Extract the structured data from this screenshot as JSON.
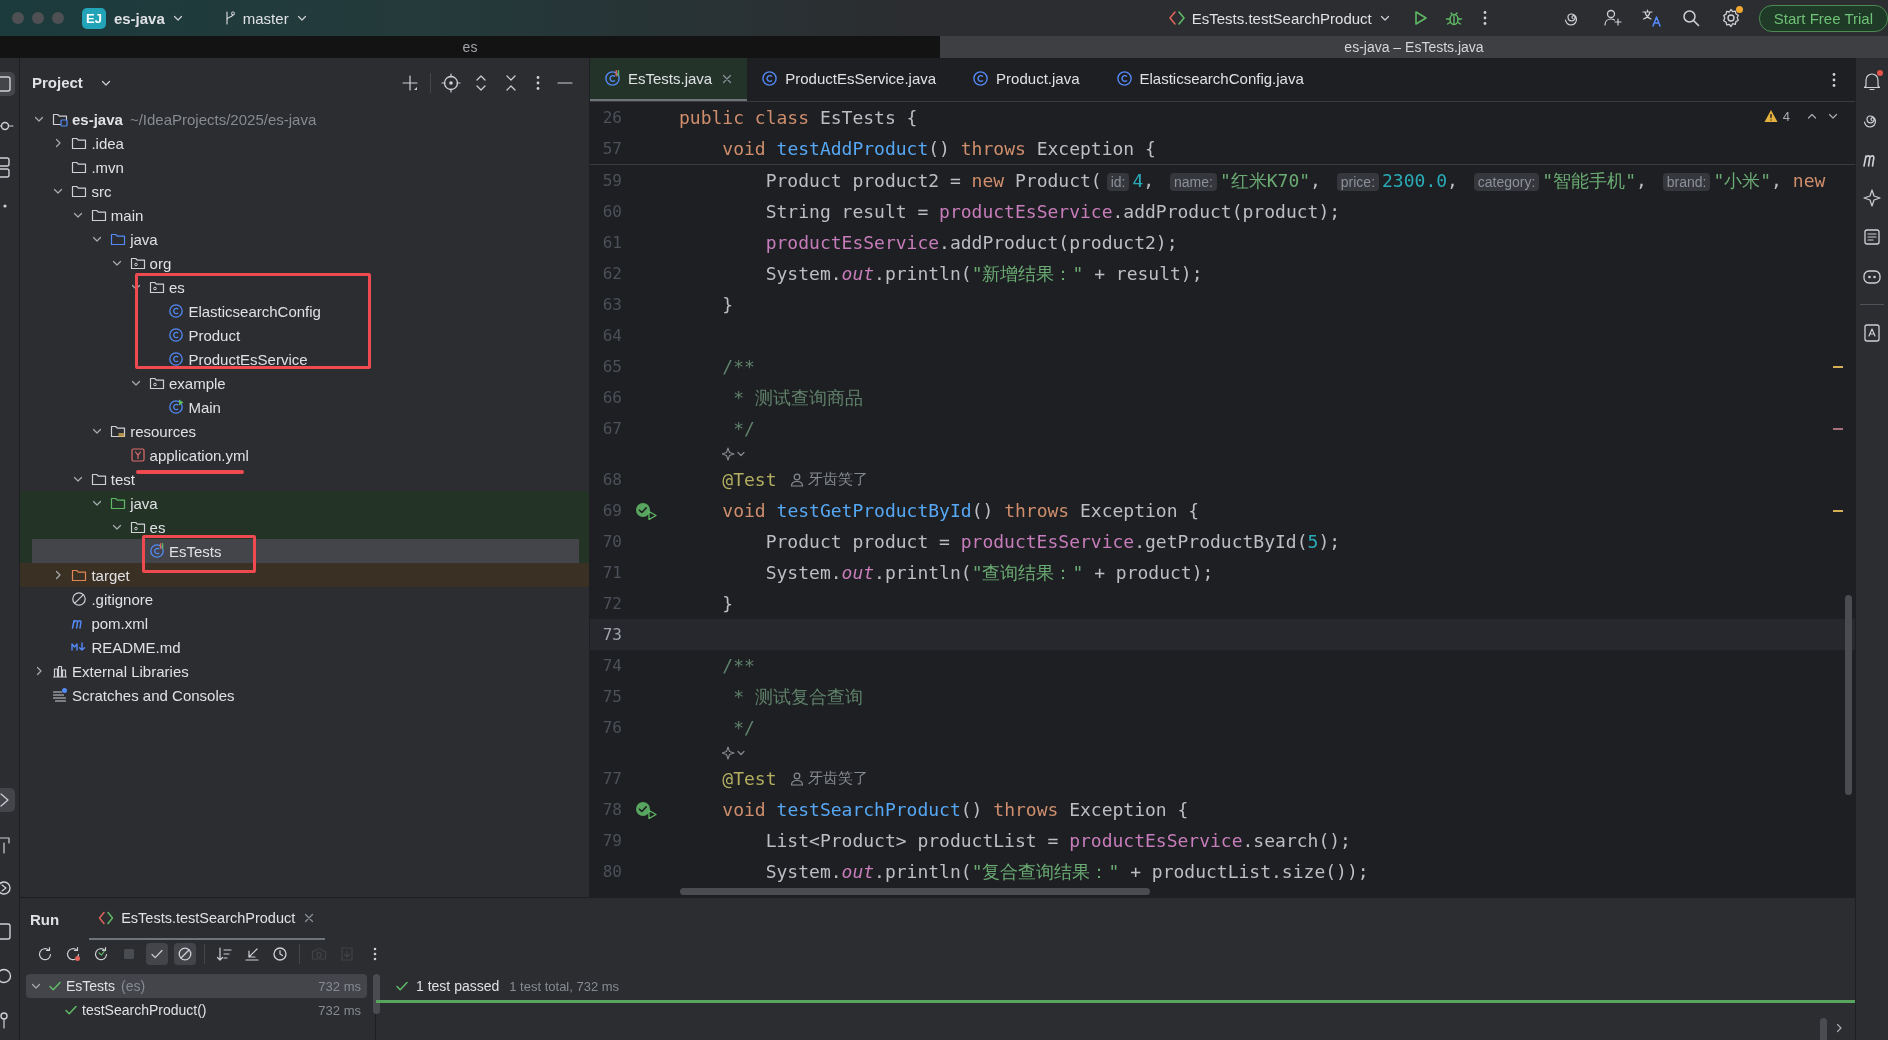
{
  "titlebar": {
    "project_badge": "EJ",
    "project": "es-java",
    "branch": "master",
    "run_config": "EsTests.testSearchProduct",
    "settings_badge": true,
    "trial_button": "Start Free Trial"
  },
  "window_tabs": [
    {
      "label": "es",
      "selected": false
    },
    {
      "label": "es-java – EsTests.java",
      "selected": true
    }
  ],
  "project_panel": {
    "title": "Project",
    "tree": [
      {
        "name": "es-java",
        "path": "~/IdeaProjects/2025/es-java",
        "kind": "module",
        "expanded": true,
        "selected": false,
        "children": [
          {
            "name": ".idea",
            "kind": "folder",
            "expanded": false,
            "selected": false
          },
          {
            "name": ".mvn",
            "kind": "folder",
            "selected": false
          },
          {
            "name": "src",
            "kind": "folder",
            "expanded": true,
            "selected": false,
            "children": [
              {
                "name": "main",
                "kind": "folder",
                "expanded": true,
                "selected": false,
                "children": [
                  {
                    "name": "java",
                    "kind": "source-folder",
                    "expanded": true,
                    "selected": false,
                    "children": [
                      {
                        "name": "org",
                        "kind": "package",
                        "expanded": true,
                        "selected": false,
                        "children": [
                          {
                            "name": "es",
                            "kind": "package",
                            "expanded": true,
                            "selected": false,
                            "children": [
                              {
                                "name": "ElasticsearchConfig",
                                "kind": "class",
                                "selected": false
                              },
                              {
                                "name": "Product",
                                "kind": "class",
                                "selected": false
                              },
                              {
                                "name": "ProductEsService",
                                "kind": "class",
                                "selected": false
                              }
                            ]
                          },
                          {
                            "name": "example",
                            "kind": "package",
                            "expanded": true,
                            "selected": false,
                            "children": [
                              {
                                "name": "Main",
                                "kind": "main-class",
                                "selected": false
                              }
                            ]
                          }
                        ]
                      }
                    ]
                  },
                  {
                    "name": "resources",
                    "kind": "resources",
                    "expanded": true,
                    "selected": false,
                    "children": [
                      {
                        "name": "application.yml",
                        "kind": "yaml",
                        "selected": false
                      }
                    ]
                  }
                ]
              },
              {
                "name": "test",
                "kind": "folder",
                "expanded": true,
                "selected": false,
                "children": [
                  {
                    "name": "java",
                    "kind": "test-folder",
                    "expanded": true,
                    "selected": false,
                    "test_scope": true,
                    "children": [
                      {
                        "name": "es",
                        "kind": "package",
                        "expanded": true,
                        "selected": false,
                        "test_scope": true,
                        "children": [
                          {
                            "name": "EsTests",
                            "kind": "test-class",
                            "selected": true,
                            "test_scope": true
                          }
                        ]
                      }
                    ]
                  }
                ]
              }
            ]
          },
          {
            "name": "target",
            "kind": "excluded-folder",
            "expanded": false,
            "selected": false,
            "excluded": true
          },
          {
            "name": ".gitignore",
            "kind": "ignore",
            "selected": false
          },
          {
            "name": "pom.xml",
            "kind": "maven",
            "selected": false
          },
          {
            "name": "README.md",
            "kind": "markdown",
            "selected": false
          }
        ]
      },
      {
        "name": "External Libraries",
        "kind": "libraries",
        "expanded": false,
        "selected": false
      },
      {
        "name": "Scratches and Consoles",
        "kind": "scratches",
        "selected": false
      }
    ]
  },
  "markups": [
    {
      "kind": "box"
    },
    {
      "kind": "underline"
    },
    {
      "kind": "box"
    }
  ],
  "editor": {
    "tabs": [
      {
        "label": "EsTests.java",
        "kind": "test-class",
        "selected": true
      },
      {
        "label": "ProductEsService.java",
        "kind": "class",
        "selected": false
      },
      {
        "label": "Product.java",
        "kind": "class",
        "selected": false
      },
      {
        "label": "ElasticsearchConfig.java",
        "kind": "class",
        "selected": false
      }
    ],
    "warnings": "4",
    "sticky_lines": [
      {
        "number": "26",
        "tokens": [
          {
            "kind": "kw",
            "text": "public class "
          },
          {
            "kind": "plain",
            "text": "EsTests {"
          }
        ]
      },
      {
        "number": "57",
        "tokens": [
          {
            "kind": "kw",
            "text": "    void "
          },
          {
            "kind": "decl",
            "text": "testAddProduct"
          },
          {
            "kind": "plain",
            "text": "() "
          },
          {
            "kind": "kw",
            "text": "throws "
          },
          {
            "kind": "plain",
            "text": "Exception {"
          }
        ]
      }
    ],
    "lines": [
      {
        "kind": "code",
        "number": "59",
        "current": false,
        "tokens": [
          {
            "kind": "plain",
            "text": "        Product product2 = "
          },
          {
            "kind": "kw",
            "text": "new "
          },
          {
            "kind": "plain",
            "text": "Product("
          },
          {
            "kind": "hint",
            "text": "id:"
          },
          {
            "kind": "num",
            "text": "4"
          },
          {
            "kind": "plain",
            "text": ", "
          },
          {
            "kind": "hint",
            "text": "name:"
          },
          {
            "kind": "str",
            "text": "\"红米K70\""
          },
          {
            "kind": "plain",
            "text": ", "
          },
          {
            "kind": "hint",
            "text": "price:"
          },
          {
            "kind": "num",
            "text": "2300.0"
          },
          {
            "kind": "plain",
            "text": ", "
          },
          {
            "kind": "hint",
            "text": "category:"
          },
          {
            "kind": "str",
            "text": "\"智能手机\""
          },
          {
            "kind": "plain",
            "text": ", "
          },
          {
            "kind": "hint",
            "text": "brand:"
          },
          {
            "kind": "str",
            "text": "\"小米\""
          },
          {
            "kind": "plain",
            "text": ", "
          },
          {
            "kind": "kw",
            "text": "new"
          }
        ]
      },
      {
        "kind": "code",
        "number": "60",
        "current": false,
        "tokens": [
          {
            "kind": "plain",
            "text": "        String result = "
          },
          {
            "kind": "field",
            "text": "productEsService"
          },
          {
            "kind": "plain",
            "text": ".addProduct(product);"
          }
        ]
      },
      {
        "kind": "code",
        "number": "61",
        "current": false,
        "tokens": [
          {
            "kind": "field",
            "text": "        productEsService"
          },
          {
            "kind": "plain",
            "text": ".addProduct(product2);"
          }
        ]
      },
      {
        "kind": "code",
        "number": "62",
        "current": false,
        "tokens": [
          {
            "kind": "plain",
            "text": "        System."
          },
          {
            "kind": "static",
            "text": "out"
          },
          {
            "kind": "plain",
            "text": ".println("
          },
          {
            "kind": "str",
            "text": "\"新增结果：\""
          },
          {
            "kind": "plain",
            "text": " + result);"
          }
        ]
      },
      {
        "kind": "code",
        "number": "63",
        "current": false,
        "tokens": [
          {
            "kind": "plain",
            "text": "    }"
          }
        ]
      },
      {
        "kind": "code",
        "number": "64",
        "current": false
      },
      {
        "kind": "code",
        "number": "65",
        "current": false,
        "warning_mark": true,
        "tokens": [
          {
            "kind": "doc",
            "text": "    /**"
          }
        ]
      },
      {
        "kind": "code",
        "number": "66",
        "current": false,
        "tokens": [
          {
            "kind": "doc",
            "text": "     * 测试查询商品"
          }
        ]
      },
      {
        "kind": "code",
        "number": "67",
        "current": false,
        "typo_mark": true,
        "tokens": [
          {
            "kind": "doc",
            "text": "     */"
          }
        ]
      },
      {
        "kind": "vision"
      },
      {
        "kind": "code",
        "number": "68",
        "current": false,
        "tokens": [
          {
            "kind": "annot",
            "text": "    @Test"
          }
        ],
        "author": "牙齿笑了"
      },
      {
        "kind": "code",
        "number": "69",
        "current": false,
        "test_passed": true,
        "warning_mark": true,
        "tokens": [
          {
            "kind": "kw",
            "text": "    void "
          },
          {
            "kind": "decl",
            "text": "testGetProductById"
          },
          {
            "kind": "plain",
            "text": "() "
          },
          {
            "kind": "kw",
            "text": "throws "
          },
          {
            "kind": "plain",
            "text": "Exception {"
          }
        ]
      },
      {
        "kind": "code",
        "number": "70",
        "current": false,
        "tokens": [
          {
            "kind": "plain",
            "text": "        Product product = "
          },
          {
            "kind": "field",
            "text": "productEsService"
          },
          {
            "kind": "plain",
            "text": ".getProductById("
          },
          {
            "kind": "num",
            "text": "5"
          },
          {
            "kind": "plain",
            "text": ");"
          }
        ]
      },
      {
        "kind": "code",
        "number": "71",
        "current": false,
        "tokens": [
          {
            "kind": "plain",
            "text": "        System."
          },
          {
            "kind": "static",
            "text": "out"
          },
          {
            "kind": "plain",
            "text": ".println("
          },
          {
            "kind": "str",
            "text": "\"查询结果：\""
          },
          {
            "kind": "plain",
            "text": " + product);"
          }
        ]
      },
      {
        "kind": "code",
        "number": "72",
        "current": false,
        "tokens": [
          {
            "kind": "plain",
            "text": "    }"
          }
        ]
      },
      {
        "kind": "code",
        "number": "73",
        "current": true
      },
      {
        "kind": "code",
        "number": "74",
        "current": false,
        "tokens": [
          {
            "kind": "doc",
            "text": "    /**"
          }
        ]
      },
      {
        "kind": "code",
        "number": "75",
        "current": false,
        "tokens": [
          {
            "kind": "doc",
            "text": "     * 测试复合查询"
          }
        ]
      },
      {
        "kind": "code",
        "number": "76",
        "current": false,
        "tokens": [
          {
            "kind": "doc",
            "text": "     */"
          }
        ]
      },
      {
        "kind": "vision"
      },
      {
        "kind": "code",
        "number": "77",
        "current": false,
        "tokens": [
          {
            "kind": "annot",
            "text": "    @Test"
          }
        ],
        "author": "牙齿笑了"
      },
      {
        "kind": "code",
        "number": "78",
        "current": false,
        "test_passed": true,
        "tokens": [
          {
            "kind": "kw",
            "text": "    void "
          },
          {
            "kind": "decl",
            "text": "testSearchProduct"
          },
          {
            "kind": "plain",
            "text": "() "
          },
          {
            "kind": "kw",
            "text": "throws "
          },
          {
            "kind": "plain",
            "text": "Exception {"
          }
        ]
      },
      {
        "kind": "code",
        "number": "79",
        "current": false,
        "tokens": [
          {
            "kind": "plain",
            "text": "        List<Product> productList = "
          },
          {
            "kind": "field",
            "text": "productEsService"
          },
          {
            "kind": "plain",
            "text": ".search();"
          }
        ]
      },
      {
        "kind": "code",
        "number": "80",
        "current": false,
        "tokens": [
          {
            "kind": "plain",
            "text": "        System."
          },
          {
            "kind": "static",
            "text": "out"
          },
          {
            "kind": "plain",
            "text": ".println("
          },
          {
            "kind": "str",
            "text": "\"复合查询结果：\""
          },
          {
            "kind": "plain",
            "text": " + productList.size());"
          }
        ]
      }
    ]
  },
  "run_panel": {
    "title": "Run",
    "tabs": [
      {
        "label": "EsTests.testSearchProduct",
        "selected": true
      }
    ],
    "toolbar_groups": [
      {
        "buttons": [
          {
            "kind": "rerun",
            "on": false,
            "disabled": false
          },
          {
            "kind": "rerun-failed",
            "on": false,
            "disabled": false
          },
          {
            "kind": "auto-rerun",
            "on": false,
            "disabled": false
          },
          {
            "kind": "stop",
            "on": false,
            "disabled": true
          },
          {
            "kind": "show-passed",
            "on": true,
            "disabled": false
          },
          {
            "kind": "show-ignored",
            "on": true,
            "disabled": false
          }
        ]
      },
      {
        "buttons": [
          {
            "kind": "sort",
            "on": false,
            "disabled": false
          },
          {
            "kind": "import",
            "on": false,
            "disabled": false
          },
          {
            "kind": "history",
            "on": false,
            "disabled": false
          }
        ]
      },
      {
        "buttons": [
          {
            "kind": "screenshot",
            "on": false,
            "disabled": true
          },
          {
            "kind": "export",
            "on": false,
            "disabled": true
          },
          {
            "kind": "more",
            "on": false,
            "disabled": false
          }
        ]
      }
    ],
    "results": [
      {
        "name": "EsTests",
        "detail": "(es)",
        "time": "732 ms",
        "passed": true,
        "expanded": true,
        "selected": true,
        "children": [
          {
            "name": "testSearchProduct()",
            "time": "732 ms",
            "passed": true,
            "selected": false
          }
        ]
      }
    ],
    "summary": {
      "passed": true,
      "text": "1 test passed",
      "detail": "1 test total, 732 ms",
      "level": 1
    }
  }
}
